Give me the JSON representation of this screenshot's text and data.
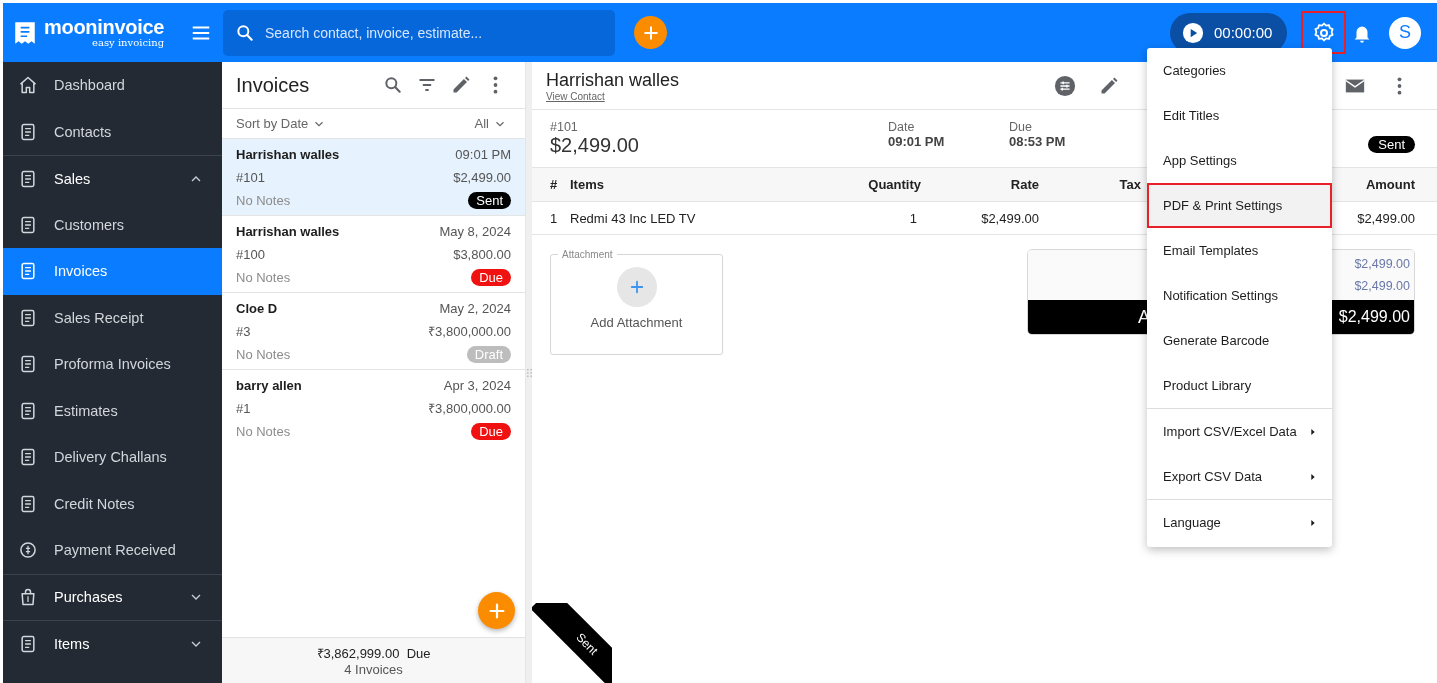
{
  "app": {
    "logo": "mooninvoice",
    "tagline": "easy invoicing"
  },
  "search": {
    "placeholder": "Search contact, invoice, estimate..."
  },
  "timer": {
    "time": "00:00:00"
  },
  "settings_button": {
    "highlighted": true
  },
  "avatar": {
    "initial": "S"
  },
  "sidebar": {
    "items": [
      {
        "label": "Dashboard",
        "selected": false
      },
      {
        "label": "Contacts",
        "selected": false
      },
      {
        "label": "Sales",
        "selected": false,
        "expanded": true,
        "children": [
          {
            "label": "Customers",
            "selected": false
          },
          {
            "label": "Invoices",
            "selected": true
          },
          {
            "label": "Sales Receipt",
            "selected": false
          },
          {
            "label": "Proforma Invoices",
            "selected": false
          },
          {
            "label": "Estimates",
            "selected": false
          },
          {
            "label": "Delivery Challans",
            "selected": false
          },
          {
            "label": "Credit Notes",
            "selected": false
          },
          {
            "label": "Payment Received",
            "selected": false
          }
        ]
      },
      {
        "label": "Purchases",
        "selected": false,
        "expanded": false
      },
      {
        "label": "Items",
        "selected": false,
        "expanded": false
      }
    ]
  },
  "invoice_list": {
    "title": "Invoices",
    "sort": "Sort by Date",
    "filter": "All",
    "items": [
      {
        "name": "Harrishan walles",
        "date": "09:01 PM",
        "number": "#101",
        "amount": "$2,499.00",
        "notes": "No Notes",
        "status": {
          "label": "Sent",
          "kind": "sent"
        },
        "selected": true
      },
      {
        "name": "Harrishan walles",
        "date": "May 8, 2024",
        "number": "#100",
        "amount": "$3,800.00",
        "notes": "No Notes",
        "status": {
          "label": "Due",
          "kind": "due"
        },
        "selected": false
      },
      {
        "name": "Cloe D",
        "date": "May 2, 2024",
        "number": "#3",
        "amount": "₹3,800,000.00",
        "notes": "No Notes",
        "status": {
          "label": "Draft",
          "kind": "draft"
        },
        "selected": false
      },
      {
        "name": "barry allen",
        "date": "Apr 3, 2024",
        "number": "#1",
        "amount": "₹3,800,000.00",
        "notes": "No Notes",
        "status": {
          "label": "Due",
          "kind": "due"
        },
        "selected": false
      }
    ],
    "footer": {
      "total": "₹3,862,999.00  Due",
      "count": "4 Invoices"
    }
  },
  "invoice": {
    "customer": "Harrishan walles",
    "contact_link": "View Contact",
    "number": "#101",
    "total": "$2,499.00",
    "date_label": "Date",
    "date": "09:01 PM",
    "due_label": "Due",
    "due": "08:53 PM",
    "status": {
      "label": "Sent",
      "kind": "sent"
    },
    "table": {
      "columns": [
        "#",
        "Items",
        "Quantity",
        "Rate",
        "Tax",
        "Amount"
      ],
      "rows": [
        {
          "index": "1",
          "item": "Redmi 43 Inc LED TV",
          "quantity": "1",
          "rate": "$2,499.00",
          "amount": "$2,499.00"
        }
      ]
    },
    "attachment": {
      "legend": "Attachment",
      "button": "Add Attachment"
    },
    "totals": {
      "lines": [
        "$2,499.00",
        "$2,499.00"
      ],
      "total_label": "A",
      "total": "$2,499.00"
    },
    "ribbon": "Sent"
  },
  "settings_menu": {
    "groups": [
      [
        {
          "label": "Categories",
          "submenu": false,
          "highlighted": false
        },
        {
          "label": "Edit Titles",
          "submenu": false,
          "highlighted": false
        },
        {
          "label": "App Settings",
          "submenu": false,
          "highlighted": false
        },
        {
          "label": "PDF & Print Settings",
          "submenu": false,
          "highlighted": true
        },
        {
          "label": "Email Templates",
          "submenu": false,
          "highlighted": false
        },
        {
          "label": "Notification Settings",
          "submenu": false,
          "highlighted": false
        },
        {
          "label": "Generate Barcode",
          "submenu": false,
          "highlighted": false
        },
        {
          "label": "Product Library",
          "submenu": false,
          "highlighted": false
        }
      ],
      [
        {
          "label": "Import CSV/Excel Data",
          "submenu": true,
          "highlighted": false
        },
        {
          "label": "Export CSV Data",
          "submenu": true,
          "highlighted": false
        }
      ],
      [
        {
          "label": "Language",
          "submenu": true,
          "highlighted": false
        }
      ]
    ]
  }
}
